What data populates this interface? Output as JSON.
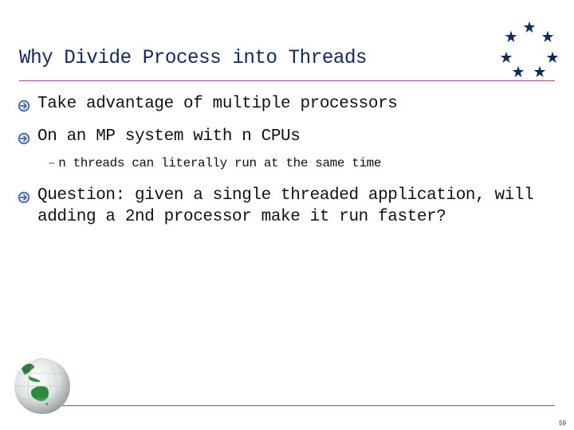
{
  "slide": {
    "title": "Why Divide Process into Threads",
    "bullets": [
      {
        "text": "Take advantage of multiple processors",
        "icon": "arrow-circle-icon"
      },
      {
        "text": "On an MP system with n CPUs",
        "icon": "arrow-circle-icon",
        "subbullets": [
          {
            "text": "n threads can literally run at the same time",
            "icon": "dash"
          }
        ]
      },
      {
        "text": "Question: given a single threaded application, will\nadding a 2nd processor make it run faster?",
        "icon": "arrow-circle-icon"
      }
    ],
    "subbullet_dash": "–",
    "page_number": "59"
  },
  "decor": {
    "logo": "star-circle-logo",
    "star_count": 7,
    "footer_image": "globe-image",
    "colors": {
      "title": "#0f2a5c",
      "rule": "#9b3f9b",
      "bullet_icon": "#4a6fb3",
      "stars": "#0f2a5c"
    }
  }
}
